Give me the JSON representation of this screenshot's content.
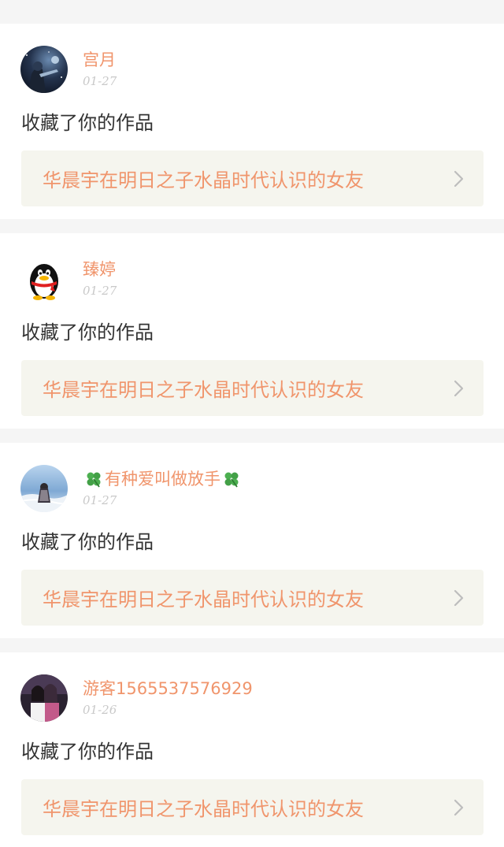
{
  "notifications": [
    {
      "user_name": "宫月",
      "date": "01-27",
      "action": "收藏了你的作品",
      "work_title": "华晨宇在明日之子水晶时代认识的女友",
      "avatar_icon": "avatar-night-sky-icon"
    },
    {
      "user_name": "臻婷",
      "date": "01-27",
      "action": "收藏了你的作品",
      "work_title": "华晨宇在明日之子水晶时代认识的女友",
      "avatar_icon": "avatar-qq-penguin-icon"
    },
    {
      "user_name": "有种爱叫做放手",
      "date": "01-27",
      "action": "收藏了你的作品",
      "work_title": "华晨宇在明日之子水晶时代认识的女友",
      "avatar_icon": "avatar-seaside-girl-icon",
      "name_decoration": "clover-icon"
    },
    {
      "user_name": "游客1565537576929",
      "date": "01-26",
      "action": "收藏了你的作品",
      "work_title": "华晨宇在明日之子水晶时代认识的女友",
      "avatar_icon": "avatar-two-girls-icon"
    }
  ],
  "colors": {
    "accent": "#f0956c",
    "text": "#333333",
    "date": "#c9c9c9",
    "link_bg": "#f5f5ee",
    "page_bg": "#f5f5f5"
  }
}
